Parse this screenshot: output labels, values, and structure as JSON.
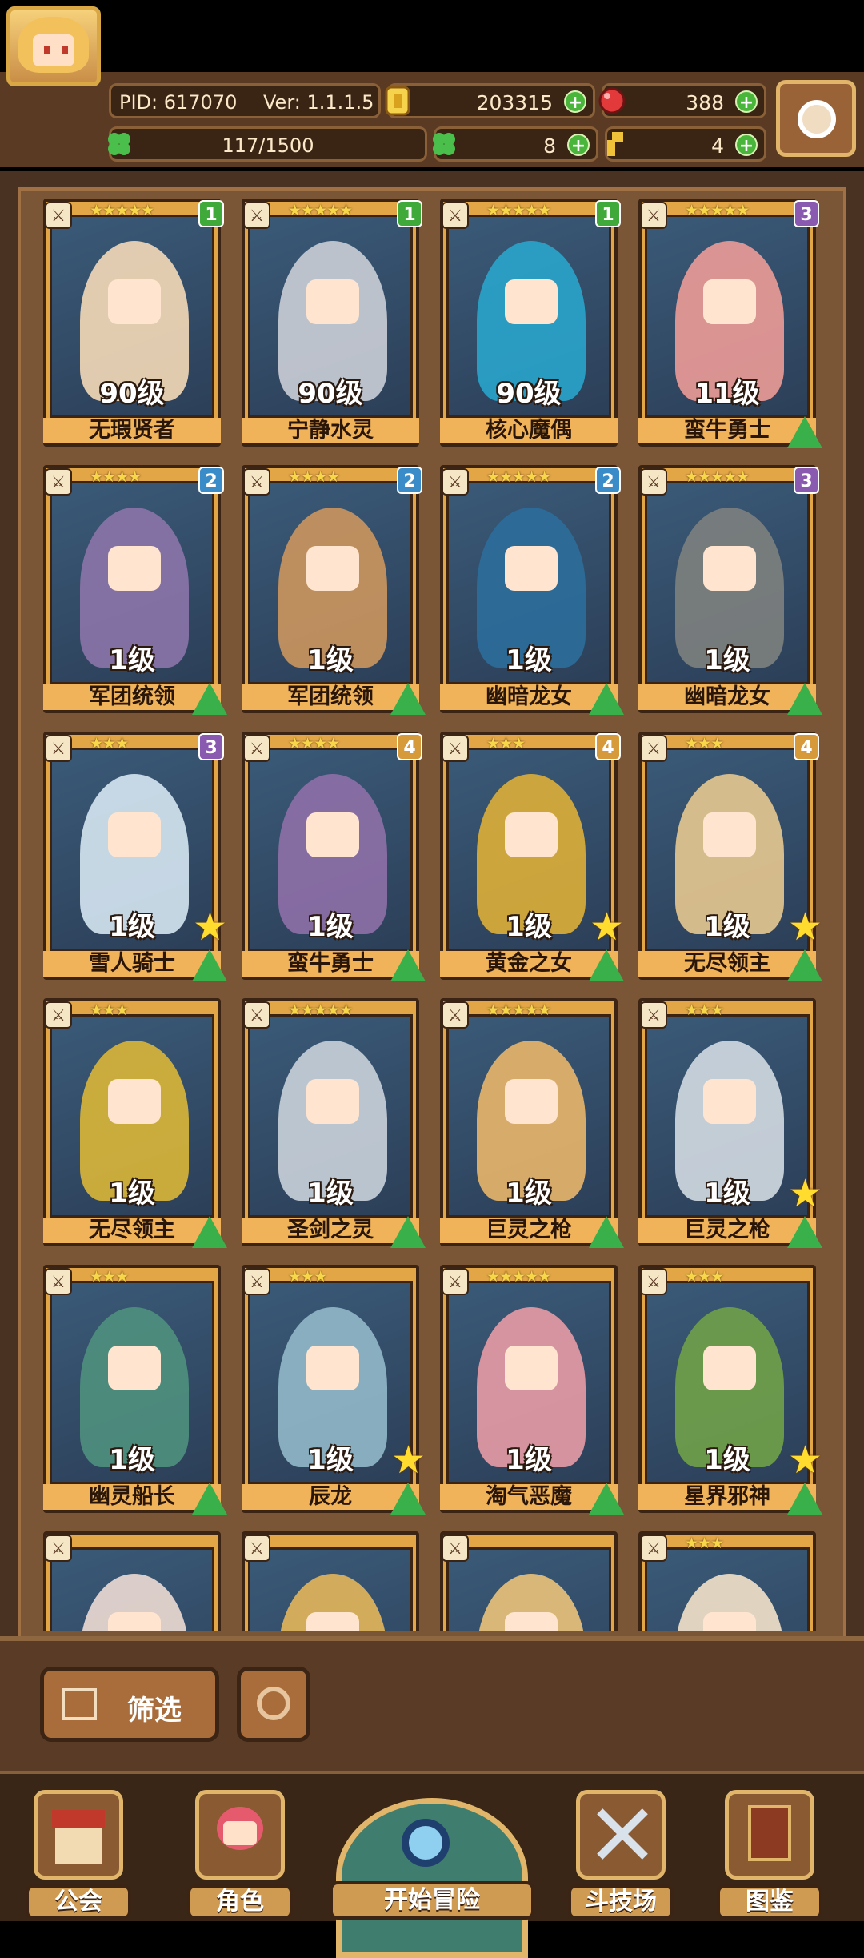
{
  "header": {
    "pid": "PID: 617070",
    "version": "Ver: 1.1.1.5",
    "gold": "203315",
    "gems": "388",
    "exp": "117/1500",
    "clover": "8",
    "keys": "4"
  },
  "cards": [
    {
      "level": "90级",
      "name": "无瑕贤者",
      "badge": "1",
      "badge_color": "#3faa3a",
      "stars": "★★★★★",
      "color": "#f0d7b6",
      "upgrade": false,
      "star": false
    },
    {
      "level": "90级",
      "name": "宁静水灵",
      "badge": "1",
      "badge_color": "#3faa3a",
      "stars": "★★★★★",
      "color": "#c8ccd4",
      "upgrade": false,
      "star": false
    },
    {
      "level": "90级",
      "name": "核心魔偶",
      "badge": "1",
      "badge_color": "#3faa3a",
      "stars": "★★★★★",
      "color": "#2aa3c9",
      "upgrade": false,
      "star": false
    },
    {
      "level": "11级",
      "name": "蛮牛勇士",
      "badge": "3",
      "badge_color": "#8a5ab0",
      "stars": "★★★★★",
      "color": "#e89a96",
      "upgrade": true,
      "star": false
    },
    {
      "level": "1级",
      "name": "军团统领",
      "badge": "2",
      "badge_color": "#3a8cc9",
      "stars": "★★★★",
      "color": "#8a74a8",
      "upgrade": true,
      "star": false
    },
    {
      "level": "1级",
      "name": "军团统领",
      "badge": "2",
      "badge_color": "#3a8cc9",
      "stars": "★★★★",
      "color": "#c9955e",
      "upgrade": true,
      "star": false
    },
    {
      "level": "1级",
      "name": "幽暗龙女",
      "badge": "2",
      "badge_color": "#3a8cc9",
      "stars": "★★★★★",
      "color": "#2d6c9a",
      "upgrade": true,
      "star": false
    },
    {
      "level": "1级",
      "name": "幽暗龙女",
      "badge": "3",
      "badge_color": "#8a5ab0",
      "stars": "★★★★★",
      "color": "#7c7f7e",
      "upgrade": true,
      "star": false
    },
    {
      "level": "1级",
      "name": "雪人骑士",
      "badge": "3",
      "badge_color": "#8a5ab0",
      "stars": "★★★",
      "color": "#d2e3ef",
      "upgrade": true,
      "star": true
    },
    {
      "level": "1级",
      "name": "蛮牛勇士",
      "badge": "4",
      "badge_color": "#d79a3a",
      "stars": "★★★★",
      "color": "#8c6fa6",
      "upgrade": true,
      "star": false
    },
    {
      "level": "1级",
      "name": "黄金之女",
      "badge": "4",
      "badge_color": "#d79a3a",
      "stars": "★★★",
      "color": "#d9ad3a",
      "upgrade": true,
      "star": true
    },
    {
      "level": "1级",
      "name": "无尽领主",
      "badge": "4",
      "badge_color": "#d79a3a",
      "stars": "★★★",
      "color": "#e3c58f",
      "upgrade": true,
      "star": true
    },
    {
      "level": "1级",
      "name": "无尽领主",
      "badge": "",
      "badge_color": "",
      "stars": "★★★",
      "color": "#d7b43a",
      "upgrade": true,
      "star": false
    },
    {
      "level": "1级",
      "name": "圣剑之灵",
      "badge": "",
      "badge_color": "",
      "stars": "★★★★★",
      "color": "#c7cfd8",
      "upgrade": true,
      "star": false
    },
    {
      "level": "1级",
      "name": "巨灵之枪",
      "badge": "",
      "badge_color": "",
      "stars": "★★★★★",
      "color": "#e5b46a",
      "upgrade": true,
      "star": false
    },
    {
      "level": "1级",
      "name": "巨灵之枪",
      "badge": "",
      "badge_color": "",
      "stars": "★★★",
      "color": "#cfd8e0",
      "upgrade": true,
      "star": true
    },
    {
      "level": "1级",
      "name": "幽灵船长",
      "badge": "",
      "badge_color": "",
      "stars": "★★★",
      "color": "#4e8f7e",
      "upgrade": true,
      "star": false
    },
    {
      "level": "1级",
      "name": "辰龙",
      "badge": "",
      "badge_color": "",
      "stars": "★★★",
      "color": "#8fb6c7",
      "upgrade": true,
      "star": true
    },
    {
      "level": "1级",
      "name": "淘气恶魔",
      "badge": "",
      "badge_color": "",
      "stars": "★★★★★",
      "color": "#e39aa4",
      "upgrade": true,
      "star": false
    },
    {
      "level": "1级",
      "name": "星界邪神",
      "badge": "",
      "badge_color": "",
      "stars": "★★★",
      "color": "#6fa04a",
      "upgrade": true,
      "star": true
    },
    {
      "level": "",
      "name": "",
      "badge": "",
      "badge_color": "",
      "stars": "",
      "color": "#e9d8d0",
      "upgrade": false,
      "star": false
    },
    {
      "level": "",
      "name": "",
      "badge": "",
      "badge_color": "",
      "stars": "",
      "color": "#e0b45a",
      "upgrade": false,
      "star": false
    },
    {
      "level": "",
      "name": "",
      "badge": "",
      "badge_color": "",
      "stars": "",
      "color": "#e6c07a",
      "upgrade": false,
      "star": false
    },
    {
      "level": "",
      "name": "",
      "badge": "",
      "badge_color": "",
      "stars": "★★★",
      "color": "#efe0c8",
      "upgrade": false,
      "star": false
    }
  ],
  "controls": {
    "filter_label": "筛选"
  },
  "nav": {
    "guild": "公会",
    "character": "角色",
    "adventure": "开始冒险",
    "arena": "斗技场",
    "codex": "图鉴"
  },
  "colors": {
    "frame": "#e2a646",
    "panel": "#7a5637",
    "upgrade": "#39b04a"
  }
}
